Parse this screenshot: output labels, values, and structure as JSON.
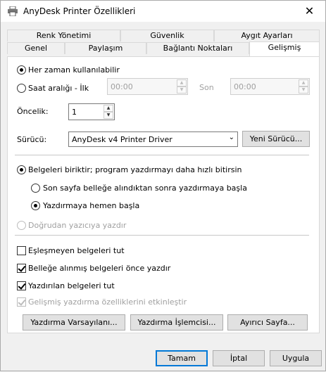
{
  "window": {
    "title": "AnyDesk Printer Özellikleri"
  },
  "tabs_row1": [
    "Renk Yönetimi",
    "Güvenlik",
    "Aygıt Ayarları"
  ],
  "tabs_row2": [
    "Genel",
    "Paylaşım",
    "Bağlantı Noktaları",
    "Gelişmiş"
  ],
  "availability": {
    "always_label": "Her zaman kullanılabilir",
    "range_label": "Saat aralığı - İlk",
    "from_value": "00:00",
    "to_label": "Son",
    "to_value": "00:00"
  },
  "priority": {
    "label": "Öncelik:",
    "value": "1"
  },
  "driver": {
    "label": "Sürücü:",
    "value": "AnyDesk v4 Printer Driver",
    "new_button": "Yeni Sürücü..."
  },
  "spool": {
    "spool_label": "Belgeleri biriktir; program yazdırmayı daha hızlı bitirsin",
    "after_last_label": "Son sayfa belleğe alındıktan sonra yazdırmaya başla",
    "immediate_label": "Yazdırmaya hemen başla",
    "direct_label": "Doğrudan yazıcıya yazdır"
  },
  "options": {
    "hold_mismatched": "Eşleşmeyen belgeleri tut",
    "spooled_first": "Belleğe alınmış belgeleri önce yazdır",
    "keep_printed": "Yazdırılan belgeleri tut",
    "advanced_features": "Gelişmiş yazdırma özelliklerini etkinleştir"
  },
  "bottom_buttons": {
    "defaults": "Yazdırma Varsayılanı...",
    "processor": "Yazdırma İşlemcisi...",
    "separator": "Ayırıcı Sayfa..."
  },
  "dialog": {
    "ok": "Tamam",
    "cancel": "İptal",
    "apply": "Uygula"
  }
}
